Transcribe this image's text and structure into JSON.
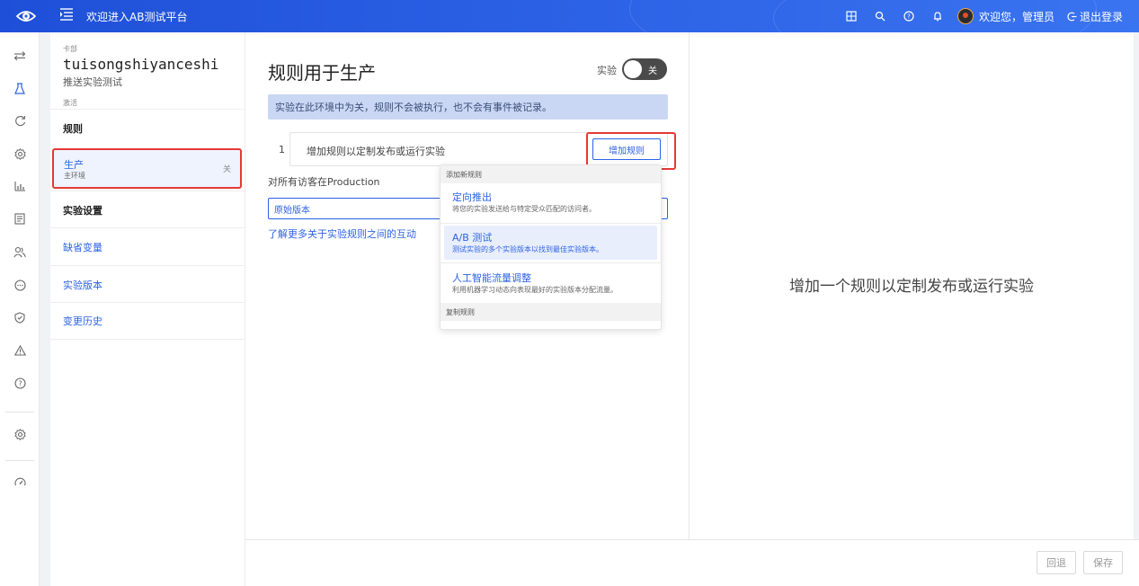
{
  "header": {
    "title": "欢迎进入AB测试平台",
    "welcome": "欢迎您，管理员",
    "logout": "退出登录",
    "icons": [
      "screen-icon",
      "search-icon",
      "help-icon",
      "bell-icon"
    ]
  },
  "rail": {
    "icons": [
      "switch-icon",
      "flask-icon",
      "refresh-icon",
      "settings-icon",
      "chart-icon",
      "document-icon",
      "users-icon",
      "chat-icon",
      "shield-icon",
      "warning-icon",
      "question-icon",
      "gear-icon",
      "dashboard-icon"
    ]
  },
  "sidebar": {
    "card_label": "卡部",
    "project_name": "tuisongshiyanceshi",
    "project_desc": "推送实验测试",
    "status": "激活",
    "rules_header": "规则",
    "env": {
      "name": "生产",
      "sub": "主环境",
      "state": "关"
    },
    "settings_header": "实验设置",
    "links": [
      "缺省变量",
      "实验版本",
      "变更历史"
    ]
  },
  "main": {
    "title": "规则用于生产",
    "toggle_label": "实验",
    "toggle_state": "关",
    "alert": "实验在此环境中为关，规则不会被执行，也不会有事件被记录。",
    "rule_number": "1",
    "rule_placeholder": "增加规则以定制发布或运行实验",
    "add_rule_button": "增加规则",
    "visitors_text": "对所有访客在Production",
    "variant": "原始版本",
    "learn_more": "了解更多关于实验规则之间的互动"
  },
  "dropdown": {
    "section_new": "添加新规则",
    "options": [
      {
        "title": "定向推出",
        "desc": "将您的实验发送给与特定受众匹配的访问者。"
      },
      {
        "title": "A/B 测试",
        "desc": "测试实验的多个实验版本以找到最佳实验版本。"
      },
      {
        "title": "人工智能流量调整",
        "desc": "利用机器学习动态向表现最好的实验版本分配流量。"
      }
    ],
    "section_copy": "复制规则"
  },
  "right_panel": {
    "message": "增加一个规则以定制发布或运行实验"
  },
  "footer": {
    "revert": "回退",
    "save": "保存"
  },
  "colors": {
    "primary": "#2d63e6",
    "highlight": "#e53935",
    "alert_bg": "#cad7f4"
  }
}
